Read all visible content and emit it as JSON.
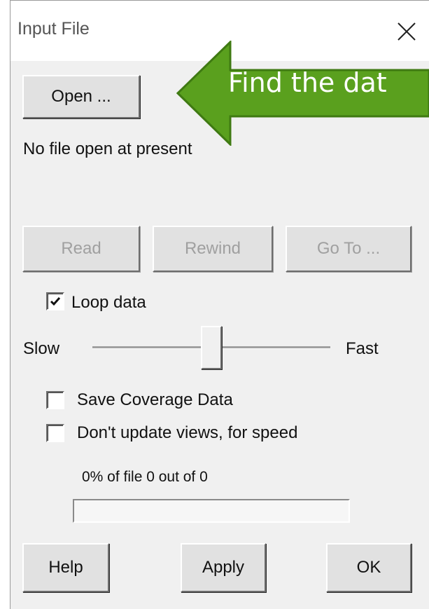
{
  "window": {
    "title": "Input File",
    "close_icon": "close-icon"
  },
  "buttons": {
    "open": "Open ...",
    "read": "Read",
    "rewind": "Rewind",
    "goto": "Go To ...",
    "help": "Help",
    "apply": "Apply",
    "ok": "OK"
  },
  "status": {
    "file_status": "No file open at present",
    "progress_text": "0% of file 0 out of 0",
    "progress_fraction": 0
  },
  "options": {
    "loop_label": "Loop data",
    "loop_checked": true,
    "save_coverage_label": "Save Coverage Data",
    "save_coverage_checked": false,
    "no_update_label": "Don't update views, for speed",
    "no_update_checked": false
  },
  "speed": {
    "slow_label": "Slow",
    "fast_label": "Fast",
    "level": 0.5
  },
  "annotation": {
    "text": "Find the dat",
    "color": "#5aa01e",
    "icon": "arrow-left-icon"
  }
}
